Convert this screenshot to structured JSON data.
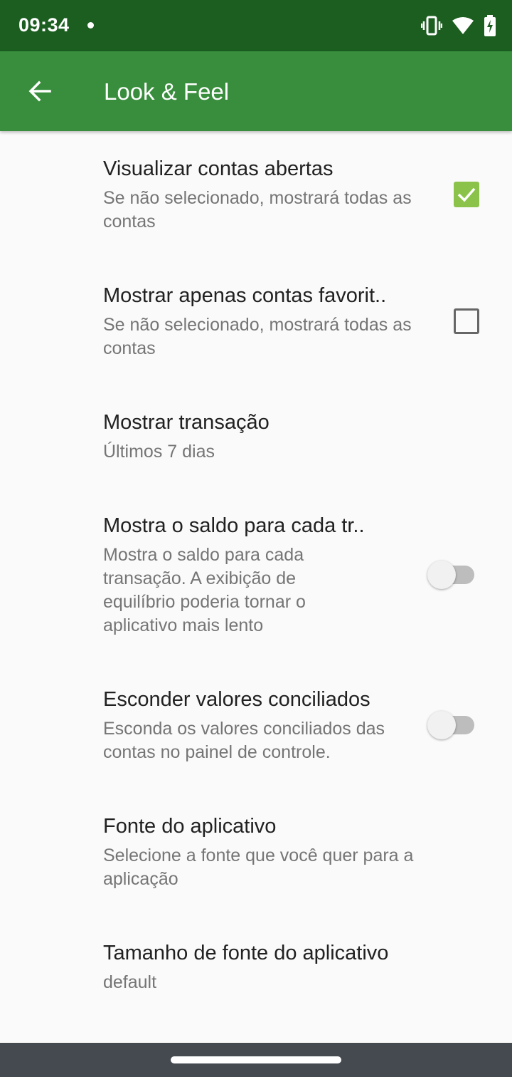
{
  "status_bar": {
    "time": "09:34"
  },
  "app_bar": {
    "title": "Look & Feel"
  },
  "preferences": [
    {
      "title": "Visualizar contas abertas",
      "summary": "Se não selecionado, mostrará todas as contas",
      "widget": "checkbox",
      "checked": true
    },
    {
      "title": "Mostrar apenas contas favorit..",
      "summary": "Se não selecionado, mostrará todas as contas",
      "widget": "checkbox",
      "checked": false
    },
    {
      "title": "Mostrar transação",
      "summary": "Últimos 7 dias"
    },
    {
      "title": "Mostra o saldo para cada tr..",
      "summary": "Mostra o saldo para cada transação. A exibição de equilíbrio poderia tornar o aplicativo mais lento",
      "widget": "switch",
      "checked": false
    },
    {
      "title": "Esconder valores conciliados",
      "summary": "Esconda os valores conciliados das contas no painel de controle.",
      "widget": "switch",
      "checked": false
    },
    {
      "title": "Fonte do aplicativo",
      "summary": "Selecione a fonte que você quer para a aplicação"
    },
    {
      "title": "Tamanho de fonte do aplicativo",
      "summary": "default"
    }
  ],
  "colors": {
    "status_bar": "#1b5e20",
    "app_bar": "#388e3c",
    "accent": "#8bc34a"
  }
}
